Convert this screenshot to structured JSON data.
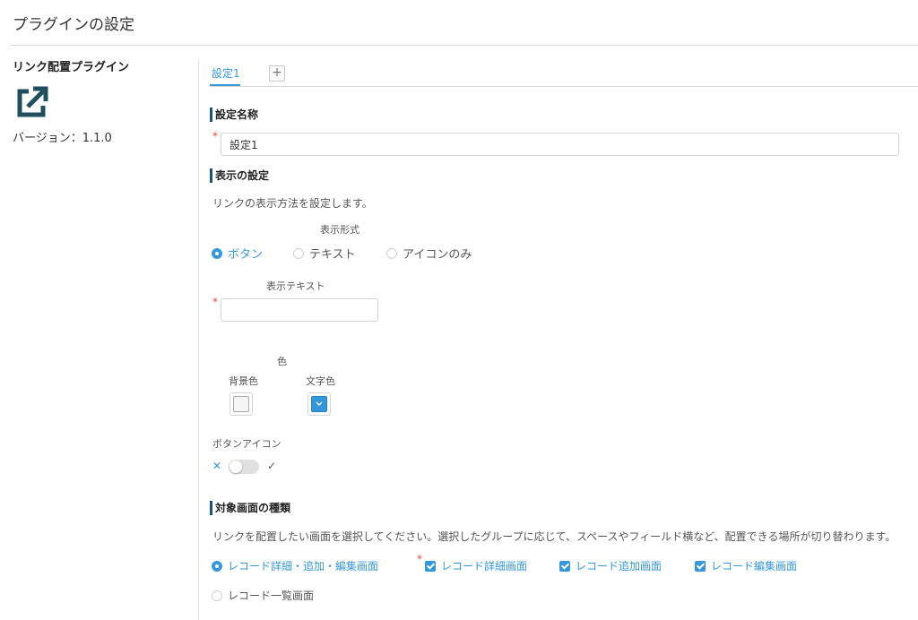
{
  "page": {
    "title": "プラグインの設定"
  },
  "plugin": {
    "name": "リンク配置プラグイン",
    "icon": "external-link-icon",
    "version": "バージョン：1.1.0"
  },
  "tabs": {
    "items": [
      {
        "label": "設定1",
        "active": true
      }
    ],
    "add_label": "+"
  },
  "settings_name": {
    "heading": "設定名称",
    "required_mark": "*",
    "value": "設定1"
  },
  "display": {
    "heading": "表示の設定",
    "description": "リンクの表示方法を設定します。",
    "format_label": "表示形式",
    "format_options": [
      {
        "label": "ボタン",
        "checked": true
      },
      {
        "label": "テキスト",
        "checked": false
      },
      {
        "label": "アイコンのみ",
        "checked": false
      }
    ],
    "text_label": "表示テキスト",
    "text_required_mark": "*",
    "text_value": "",
    "color_label": "色",
    "bg_color_label": "背景色",
    "text_color_label": "文字色",
    "button_icon_label": "ボタンアイコン",
    "toggle_off_glyph": "✕",
    "toggle_on_glyph": "✓",
    "button_icon_enabled": false
  },
  "target": {
    "heading": "対象画面の種類",
    "description": "リンクを配置したい画面を選択してください。選択したグループに応じて、スペースやフィールド横など、配置できる場所が切り替わります。",
    "group_options": [
      {
        "label": "レコード詳細・追加・編集画面",
        "checked": true
      },
      {
        "label": "レコード一覧画面",
        "checked": false
      }
    ],
    "required_mark": "*",
    "screen_checkboxes": [
      {
        "label": "レコード詳細画面",
        "checked": true
      },
      {
        "label": "レコード追加画面",
        "checked": true
      },
      {
        "label": "レコード編集画面",
        "checked": true
      }
    ]
  },
  "colors": {
    "accent": "#3498db",
    "heading_bar": "#1f4e79",
    "required": "#e74c3c"
  }
}
